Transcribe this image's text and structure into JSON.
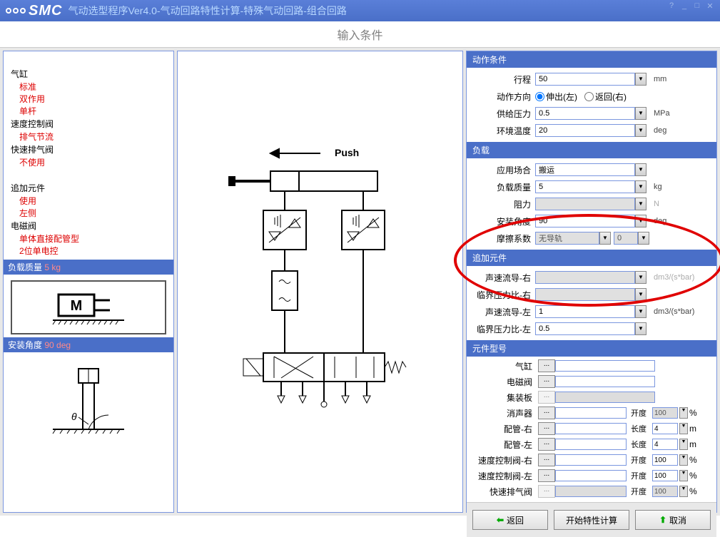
{
  "titlebar": {
    "logo": "SMC",
    "title": "气动选型程序Ver4.0-气动回路特性计算-特殊气动回路-组合回路"
  },
  "main_title": "输入条件",
  "left": {
    "cylinder": "气缸",
    "cylinder_std": "标准",
    "cylinder_double": "双作用",
    "cylinder_single": "单杆",
    "speed_valve": "速度控制阀",
    "speed_exhaust": "排气节流",
    "quick_exhaust": "快速排气阀",
    "quick_none": "不使用",
    "addon": "追加元件",
    "addon_use": "使用",
    "addon_left": "左侧",
    "solenoid": "电磁阀",
    "solenoid_type": "单体直接配管型",
    "solenoid_2pos": "2位单电控",
    "load_mass_hdr": "负载质量",
    "load_mass_val": "5 kg",
    "install_angle_hdr": "安装角度",
    "install_angle_val": "90 deg"
  },
  "sections": {
    "action": "动作条件",
    "load": "负载",
    "addon": "追加元件",
    "model": "元件型号"
  },
  "action": {
    "stroke_label": "行程",
    "stroke_val": "50",
    "stroke_unit": "mm",
    "dir_label": "动作方向",
    "dir_out": "伸出(左)",
    "dir_in": "返回(右)",
    "supply_label": "供给压力",
    "supply_val": "0.5",
    "supply_unit": "MPa",
    "temp_label": "环境温度",
    "temp_val": "20",
    "temp_unit": "deg"
  },
  "load": {
    "app_label": "应用场合",
    "app_val": "搬运",
    "mass_label": "负载质量",
    "mass_val": "5",
    "mass_unit": "kg",
    "resist_label": "阻力",
    "resist_val": "",
    "resist_unit": "N",
    "angle_label": "安装角度",
    "angle_val": "90",
    "angle_unit": "deg",
    "friction_label": "摩擦系数",
    "friction_val": "无导轨",
    "friction_num": "0"
  },
  "addon": {
    "sonic_r_label": "声速流导-右",
    "sonic_r_val": "",
    "sonic_r_unit": "dm3/(s*bar)",
    "crit_r_label": "临界压力比-右",
    "crit_r_val": "",
    "sonic_l_label": "声速流导-左",
    "sonic_l_val": "1",
    "sonic_l_unit": "dm3/(s*bar)",
    "crit_l_label": "临界压力比-左",
    "crit_l_val": "0.5"
  },
  "model": {
    "cylinder_label": "气缸",
    "solenoid_label": "电磁阀",
    "manifold_label": "集装板",
    "silencer_label": "消声器",
    "pipe_r_label": "配管-右",
    "pipe_l_label": "配管-左",
    "speed_r_label": "速度控制阀-右",
    "speed_l_label": "速度控制阀-左",
    "quick_label": "快速排气阀",
    "open_label": "开度",
    "len_label": "长度",
    "open_100": "100",
    "len_4": "4",
    "pct": "%",
    "m": "m"
  },
  "buttons": {
    "back": "返回",
    "calc": "开始特性计算",
    "cancel": "取消"
  },
  "diagram": {
    "push": "Push"
  }
}
